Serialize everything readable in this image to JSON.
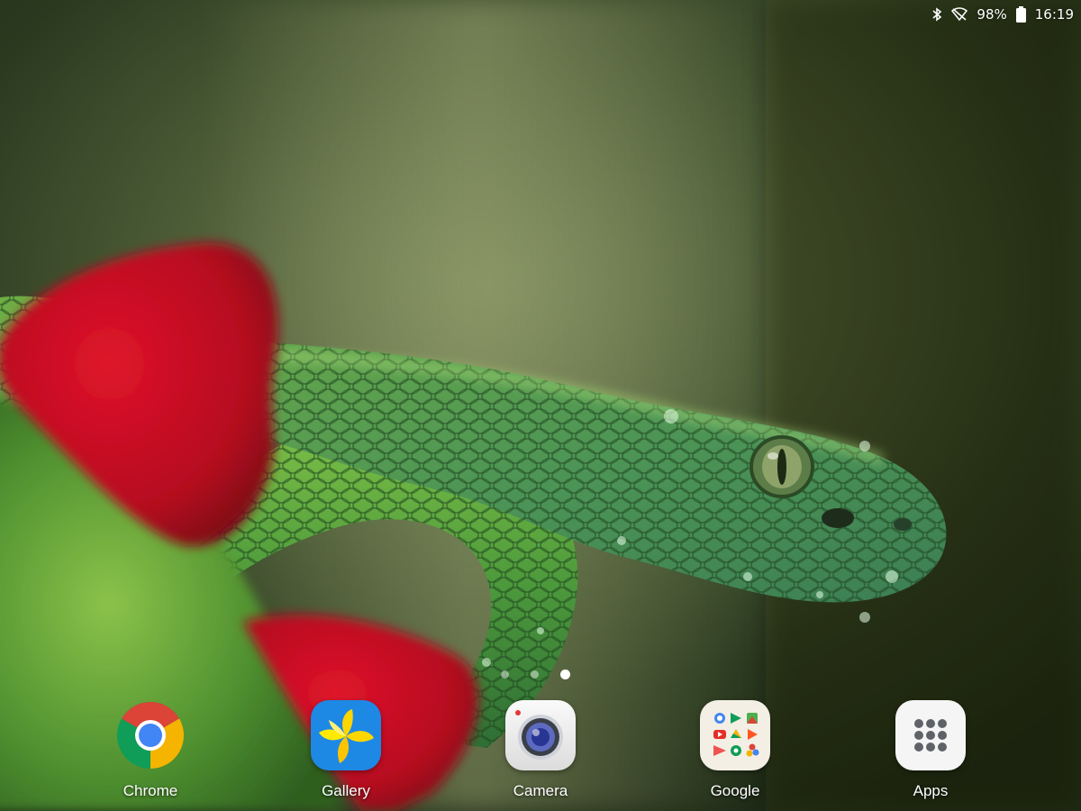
{
  "status_bar": {
    "bluetooth_icon": "bluetooth-icon",
    "signal_icon": "no-signal-icon",
    "battery_percent": "98%",
    "battery_icon": "battery-icon",
    "time": "16:19"
  },
  "page_indicator": {
    "pages": 3,
    "active_page": 3
  },
  "dock": {
    "apps": [
      {
        "label": "Chrome",
        "icon": "chrome-icon"
      },
      {
        "label": "Gallery",
        "icon": "gallery-icon"
      },
      {
        "label": "Camera",
        "icon": "camera-icon"
      },
      {
        "label": "Google",
        "icon": "google-folder-icon"
      },
      {
        "label": "Apps",
        "icon": "apps-grid-icon"
      }
    ]
  },
  "colors": {
    "chrome_red": "#DB4437",
    "chrome_yellow": "#F4B400",
    "chrome_green": "#0F9D58",
    "chrome_blue": "#4285F4",
    "gallery_blue": "#1E88E5",
    "gallery_yellow": "#FFD600"
  }
}
